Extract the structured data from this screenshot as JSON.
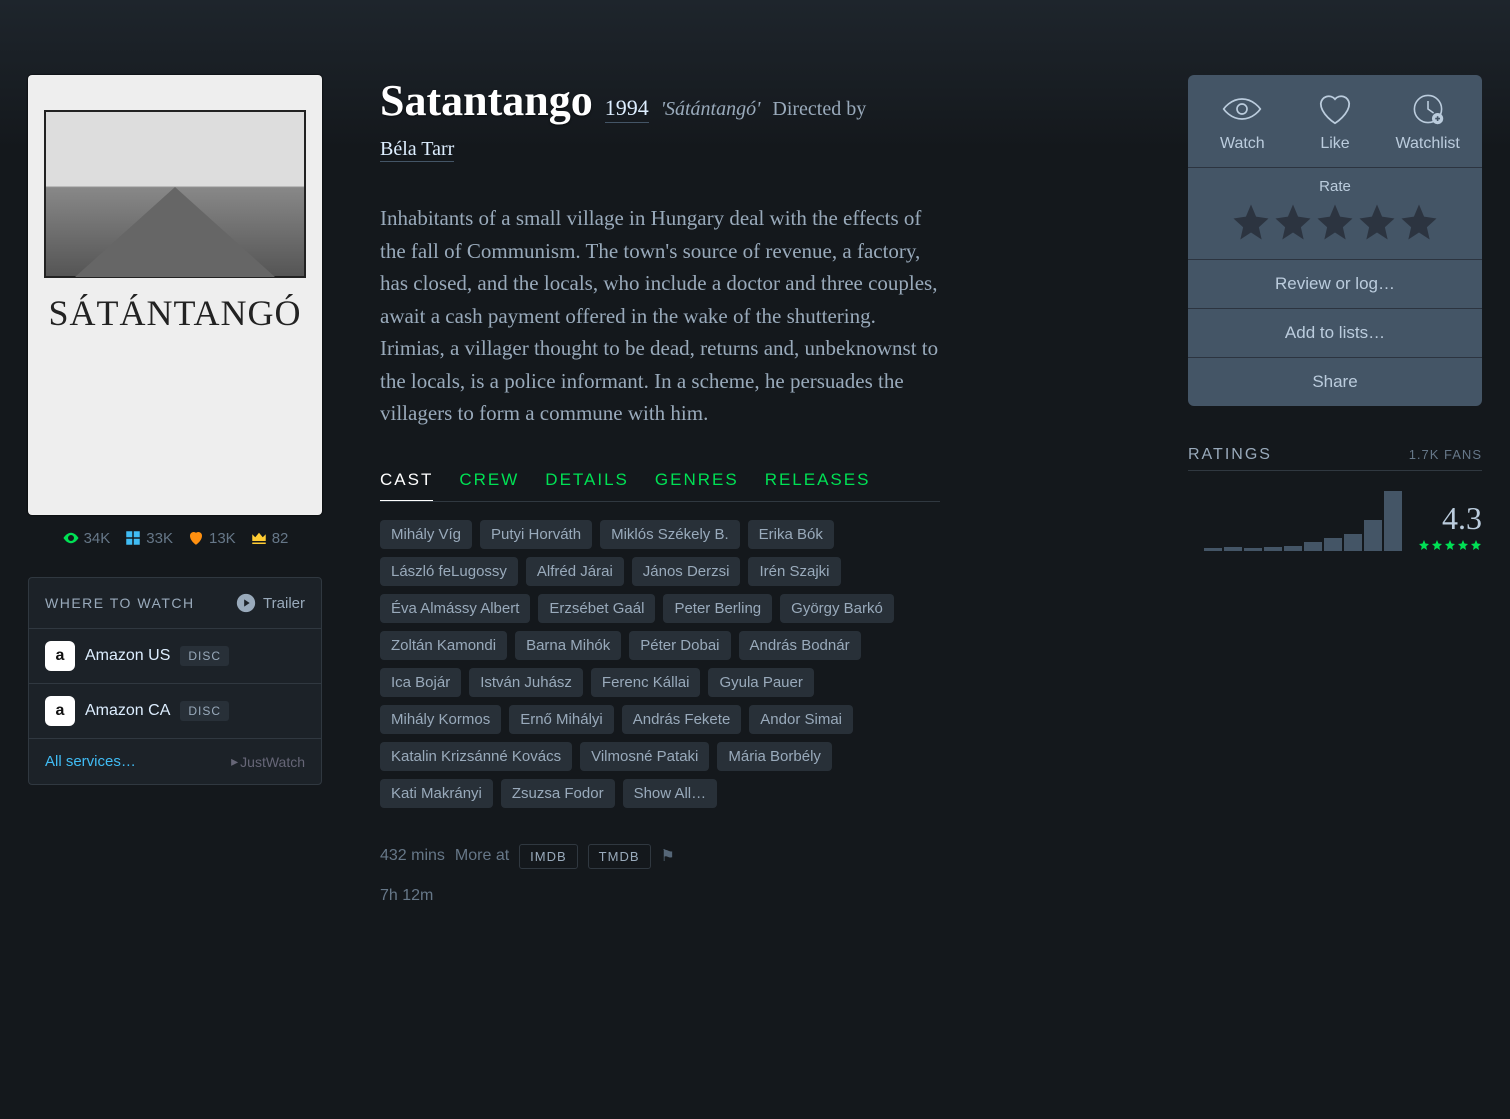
{
  "film": {
    "title": "Satantango",
    "year": "1994",
    "original_title": "'Sátántangó'",
    "directed_by_label": "Directed by",
    "director": "Béla Tarr",
    "poster_title": "SÁTÁNTANGÓ",
    "synopsis": "Inhabitants of a small village in Hungary deal with the effects of the fall of Communism. The town's source of revenue, a factory, has closed, and the locals, who include a doctor and three couples, await a cash payment offered in the wake of the shuttering. Irimias, a villager thought to be dead, returns and, unbeknownst to the locals, is a police informant. In a scheme, he persuades the villagers to form a commune with him."
  },
  "stats": {
    "watched": "34K",
    "lists": "33K",
    "liked": "13K",
    "top": "82"
  },
  "where": {
    "title": "WHERE TO WATCH",
    "trailer": "Trailer",
    "services": [
      {
        "name": "Amazon US",
        "badge": "DISC"
      },
      {
        "name": "Amazon CA",
        "badge": "DISC"
      }
    ],
    "all": "All services…",
    "provider": "JustWatch"
  },
  "tabs": [
    "CAST",
    "CREW",
    "DETAILS",
    "GENRES",
    "RELEASES"
  ],
  "cast": [
    "Mihály Víg",
    "Putyi Horváth",
    "Miklós Székely B.",
    "Erika Bók",
    "László feLugossy",
    "Alfréd Járai",
    "János Derzsi",
    "Irén Szajki",
    "Éva Almássy Albert",
    "Erzsébet Gaál",
    "Peter Berling",
    "György Barkó",
    "Zoltán Kamondi",
    "Barna Mihók",
    "Péter Dobai",
    "András Bodnár",
    "Ica Bojár",
    "István Juhász",
    "Ferenc Kállai",
    "Gyula Pauer",
    "Mihály Kormos",
    "Ernő Mihályi",
    "András Fekete",
    "Andor Simai",
    "Katalin Krizsánné Kovács",
    "Vilmosné Pataki",
    "Mária Borbély",
    "Kati Makrányi",
    "Zsuzsa Fodor",
    "Show All…"
  ],
  "runtime": {
    "mins": "432 mins",
    "more_at": "More at",
    "imdb": "IMDB",
    "tmdb": "TMDB",
    "hm": "7h 12m"
  },
  "actions": {
    "watch": "Watch",
    "like": "Like",
    "watchlist": "Watchlist",
    "rate": "Rate",
    "review": "Review or log…",
    "lists": "Add to lists…",
    "share": "Share"
  },
  "ratings": {
    "title": "RATINGS",
    "fans": "1.7K FANS",
    "average": "4.3",
    "histogram": [
      3,
      4,
      3,
      4,
      5,
      8,
      12,
      16,
      28,
      55
    ]
  }
}
